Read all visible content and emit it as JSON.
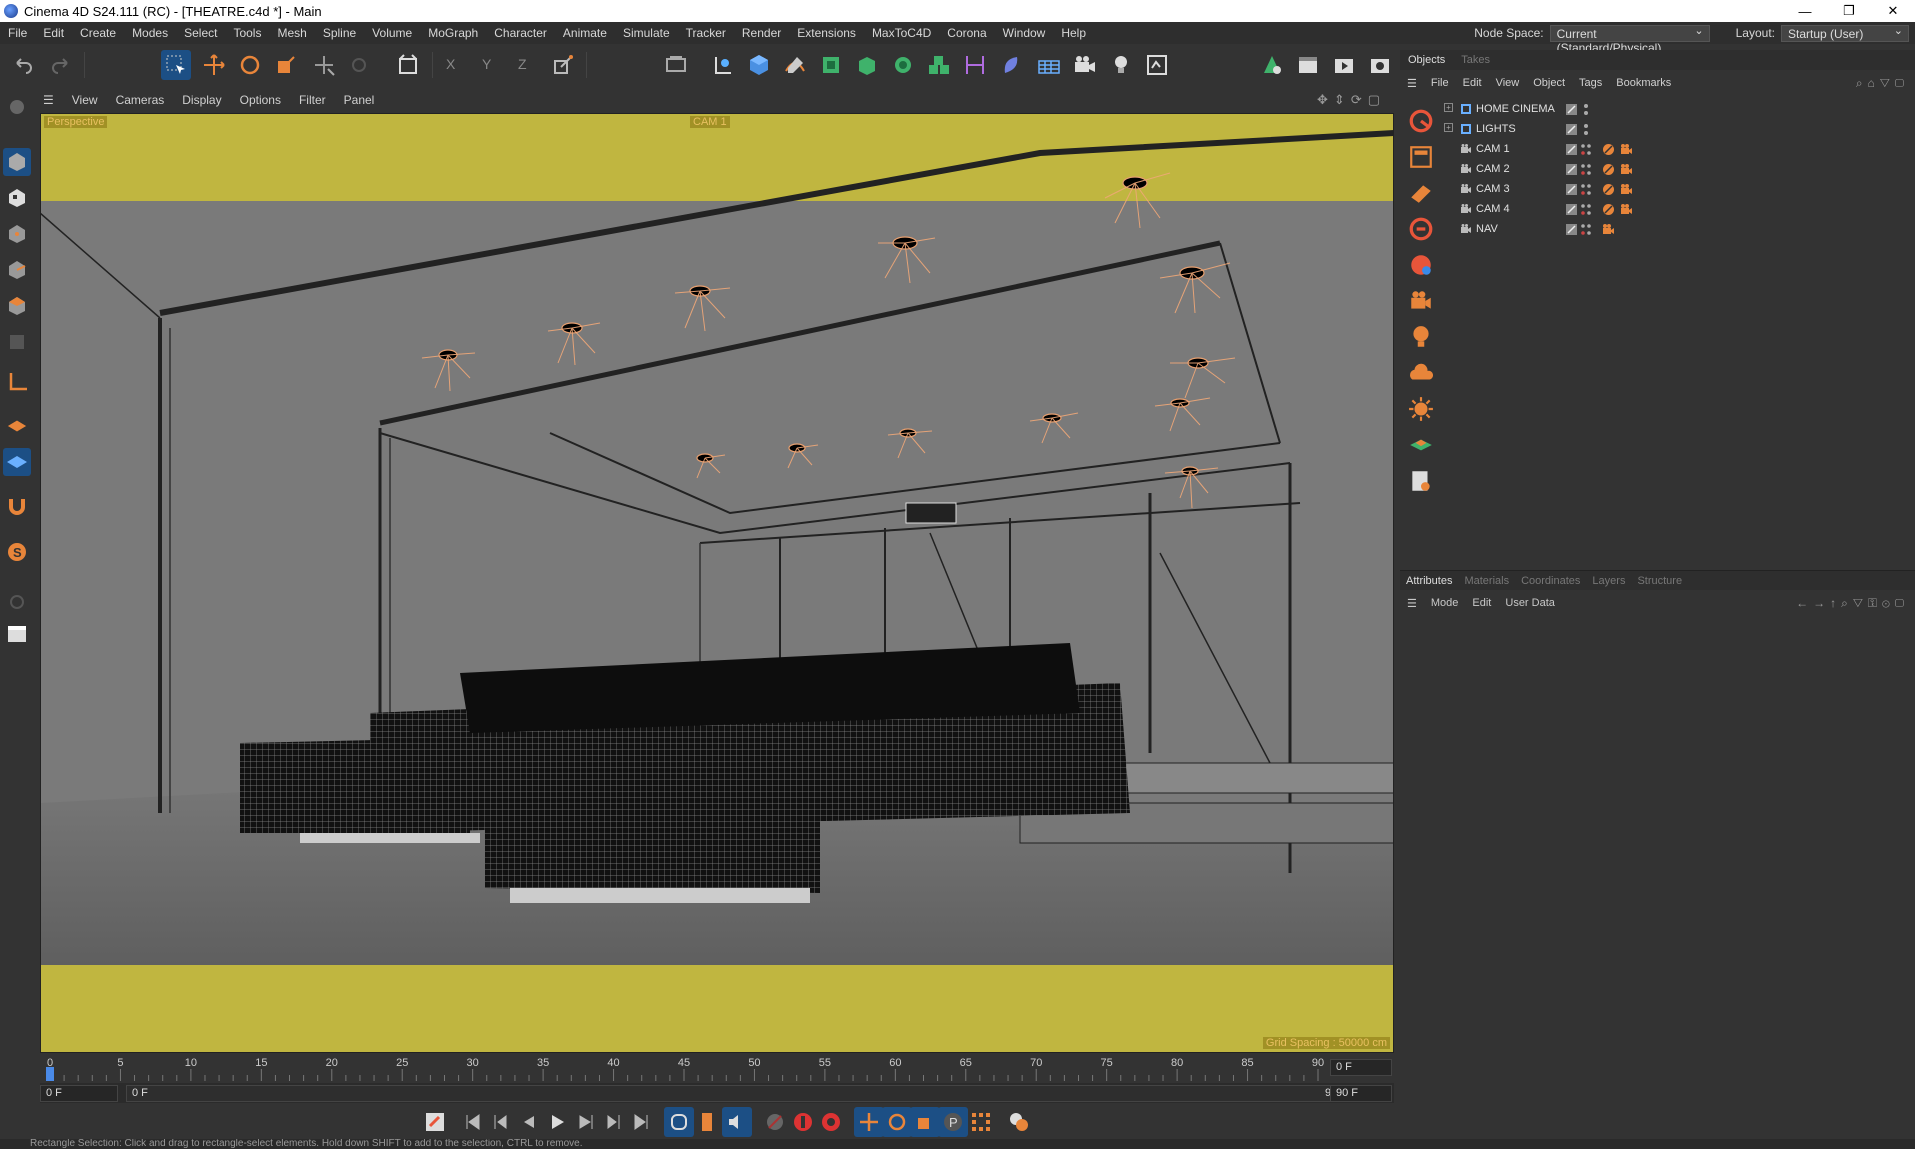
{
  "window": {
    "title": "Cinema 4D S24.111 (RC) - [THEATRE.c4d *] - Main",
    "controls": [
      "—",
      "❐",
      "✕"
    ]
  },
  "menubar": {
    "items": [
      "File",
      "Edit",
      "Create",
      "Modes",
      "Select",
      "Tools",
      "Mesh",
      "Spline",
      "Volume",
      "MoGraph",
      "Character",
      "Animate",
      "Simulate",
      "Tracker",
      "Render",
      "Extensions",
      "MaxToC4D",
      "Corona",
      "Window",
      "Help"
    ],
    "node_space_label": "Node Space:",
    "node_space_value": "Current (Standard/Physical)",
    "layout_label": "Layout:",
    "layout_value": "Startup (User)"
  },
  "viewport": {
    "menu": [
      "View",
      "Cameras",
      "Display",
      "Options",
      "Filter",
      "Panel"
    ],
    "projection_label": "Perspective",
    "camera_label": "CAM 1",
    "grid_spacing": "Grid Spacing : 50000 cm",
    "safe_frame_color": "#c8bd3a"
  },
  "timeline": {
    "ticks": [
      "0",
      "5",
      "10",
      "15",
      "20",
      "25",
      "30",
      "35",
      "40",
      "45",
      "50",
      "55",
      "60",
      "65",
      "70",
      "75",
      "80",
      "85",
      "90"
    ],
    "current_frame": "0 F",
    "end_frame_field": "0 F",
    "start_field": "0 F",
    "range_start": "0 F",
    "range_end": "90 F",
    "max_field": "90 F"
  },
  "objects_panel": {
    "tabs": [
      "Objects",
      "Takes"
    ],
    "menu": [
      "File",
      "Edit",
      "View",
      "Object",
      "Tags",
      "Bookmarks"
    ],
    "items": [
      {
        "name": "HOME CINEMA",
        "type": "layer"
      },
      {
        "name": "LIGHTS",
        "type": "layer"
      },
      {
        "name": "CAM 1",
        "type": "camera"
      },
      {
        "name": "CAM 2",
        "type": "camera"
      },
      {
        "name": "CAM 3",
        "type": "camera"
      },
      {
        "name": "CAM 4",
        "type": "camera"
      },
      {
        "name": "NAV",
        "type": "camera"
      }
    ]
  },
  "attributes_panel": {
    "tabs": [
      "Attributes",
      "Materials",
      "Coordinates",
      "Layers",
      "Structure"
    ],
    "menu": [
      "Mode",
      "Edit",
      "User Data"
    ]
  },
  "status": {
    "text": "Rectangle Selection: Click and drag to rectangle-select elements. Hold down SHIFT to add to the selection, CTRL to remove."
  },
  "colors": {
    "accent_blue": "#1c4f85",
    "orange_icon": "#e8853a",
    "panel_bg": "#333333"
  }
}
